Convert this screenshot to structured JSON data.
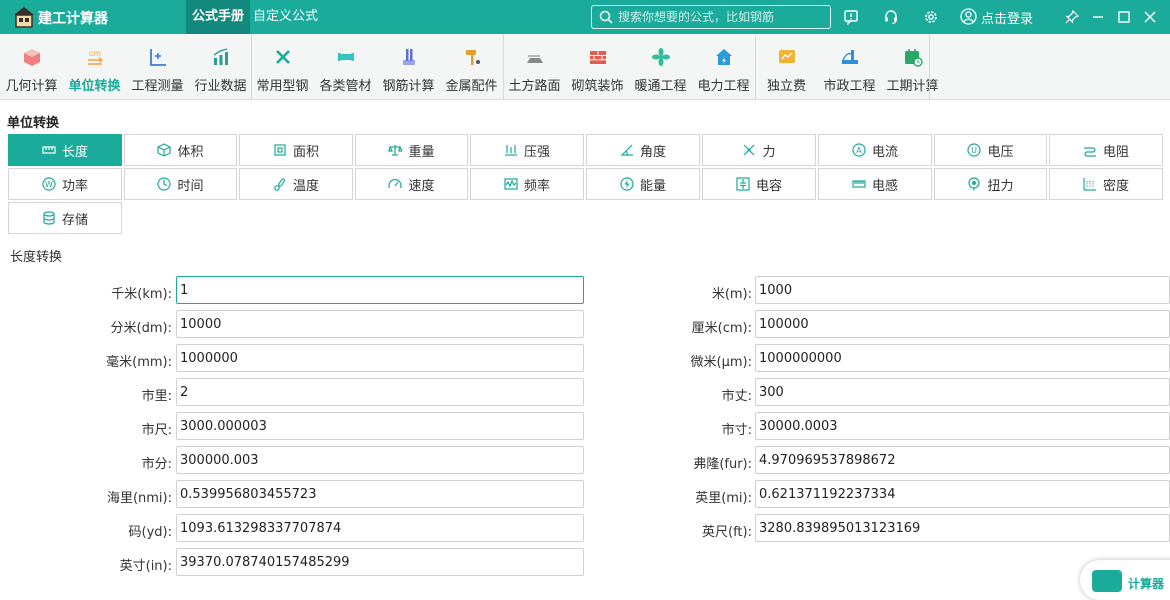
{
  "app": {
    "title": "建工计算器"
  },
  "main_tabs": [
    {
      "label": "公式手册",
      "active": true
    },
    {
      "label": "自定义公式",
      "active": false
    }
  ],
  "search": {
    "placeholder": "搜索你想要的公式，比如钢筋"
  },
  "login": {
    "label": "点击登录"
  },
  "toolbar": [
    {
      "label": "几何计算",
      "icon": "cube-icon",
      "color": "#f06a6a"
    },
    {
      "label": "单位转换",
      "icon": "unit-convert-icon",
      "color": "#f4a742",
      "active": true
    },
    {
      "label": "工程测量",
      "icon": "axis-measure-icon",
      "color": "#3b7ddd"
    },
    {
      "label": "行业数据",
      "icon": "bar-chart-icon",
      "color": "#2a9d8f"
    },
    {
      "label": "常用型钢",
      "icon": "wrench-icon",
      "color": "#1aab9a"
    },
    {
      "label": "各类管材",
      "icon": "pipe-icon",
      "color": "#35c4c4"
    },
    {
      "label": "钢筋计算",
      "icon": "rebar-icon",
      "color": "#5b6fd6"
    },
    {
      "label": "金属配件",
      "icon": "hammer-icon",
      "color": "#e0a030"
    },
    {
      "label": "土方路面",
      "icon": "road-icon",
      "color": "#8a8a8a"
    },
    {
      "label": "砌筑装饰",
      "icon": "brick-icon",
      "color": "#e65c4f"
    },
    {
      "label": "暖通工程",
      "icon": "fan-icon",
      "color": "#2fbf9a"
    },
    {
      "label": "电力工程",
      "icon": "house-power-icon",
      "color": "#2a9cd8"
    },
    {
      "label": "独立费",
      "icon": "fee-icon",
      "color": "#f2b233"
    },
    {
      "label": "市政工程",
      "icon": "bridge-icon",
      "color": "#2f8fd8"
    },
    {
      "label": "工期计算",
      "icon": "calendar-icon",
      "color": "#2aa86a"
    }
  ],
  "section_title": "单位转换",
  "categories": [
    {
      "label": "长度",
      "icon": "ruler-icon",
      "active": true
    },
    {
      "label": "体积",
      "icon": "volume-icon"
    },
    {
      "label": "面积",
      "icon": "area-icon"
    },
    {
      "label": "重量",
      "icon": "scale-icon"
    },
    {
      "label": "压强",
      "icon": "pressure-icon"
    },
    {
      "label": "角度",
      "icon": "angle-icon"
    },
    {
      "label": "力",
      "icon": "force-icon"
    },
    {
      "label": "电流",
      "icon": "current-icon"
    },
    {
      "label": "电压",
      "icon": "voltage-icon"
    },
    {
      "label": "电阻",
      "icon": "resistance-icon"
    },
    {
      "label": "功率",
      "icon": "power-icon"
    },
    {
      "label": "时间",
      "icon": "clock-icon"
    },
    {
      "label": "温度",
      "icon": "thermometer-icon"
    },
    {
      "label": "速度",
      "icon": "speed-icon"
    },
    {
      "label": "频率",
      "icon": "frequency-icon"
    },
    {
      "label": "能量",
      "icon": "energy-icon"
    },
    {
      "label": "电容",
      "icon": "capacitor-icon"
    },
    {
      "label": "电感",
      "icon": "inductor-icon"
    },
    {
      "label": "扭力",
      "icon": "torque-icon"
    },
    {
      "label": "密度",
      "icon": "density-icon"
    },
    {
      "label": "存储",
      "icon": "storage-icon"
    }
  ],
  "converter_title": "长度转换",
  "fields_left": [
    {
      "label": "千米(km):",
      "value": "1"
    },
    {
      "label": "分米(dm):",
      "value": "10000"
    },
    {
      "label": "毫米(mm):",
      "value": "1000000"
    },
    {
      "label": "市里:",
      "value": "2"
    },
    {
      "label": "市尺:",
      "value": "3000.000003"
    },
    {
      "label": "市分:",
      "value": "300000.003"
    },
    {
      "label": "海里(nmi):",
      "value": "0.539956803455723"
    },
    {
      "label": "码(yd):",
      "value": "1093.613298337707874"
    },
    {
      "label": "英寸(in):",
      "value": "39370.078740157485299"
    }
  ],
  "fields_right": [
    {
      "label": "米(m):",
      "value": "1000"
    },
    {
      "label": "厘米(cm):",
      "value": "100000"
    },
    {
      "label": "微米(μm):",
      "value": "1000000000"
    },
    {
      "label": "市丈:",
      "value": "300"
    },
    {
      "label": "市寸:",
      "value": "30000.0003"
    },
    {
      "label": "弗隆(fur):",
      "value": "4.970969537898672"
    },
    {
      "label": "英里(mi):",
      "value": "0.621371192237334"
    },
    {
      "label": "英尺(ft):",
      "value": "3280.839895013123169"
    }
  ],
  "floating_calc": {
    "label": "计算器"
  },
  "colors": {
    "accent": "#1aab9a",
    "accent_dark": "#12897c"
  }
}
